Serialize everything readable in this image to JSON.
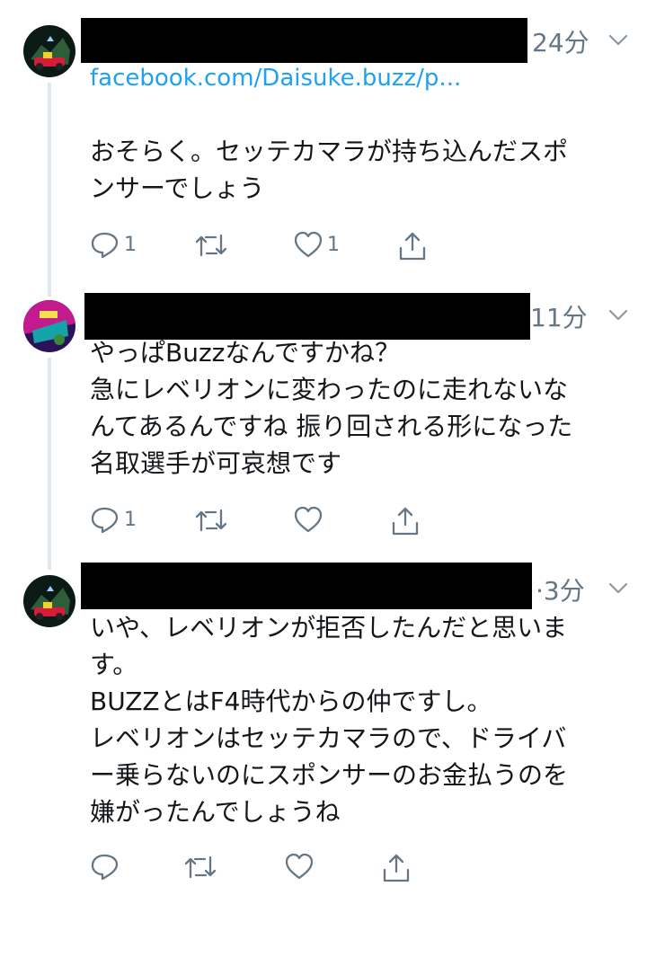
{
  "tweets": [
    {
      "time": "24分",
      "link": "facebook.com/Daisuke.buzz/p...",
      "lines": [
        "おそらく。セッテカマラが持ち込んだスポ",
        "ンサーでしょう"
      ],
      "reply_count": "1",
      "like_count": "1"
    },
    {
      "time": "11分",
      "lines": [
        "やっぱBuzzなんですかね？",
        "急にレベリオンに変わったのに走れないな",
        "んてあるんですね 振り回される形になった",
        "名取選手が可哀想です"
      ],
      "reply_count": "1"
    },
    {
      "time": "·3分",
      "lines": [
        "いや、レベリオンが拒否したんだと思いま",
        "す。",
        "BUZZとはF4時代からの仲ですし。",
        "レベリオンはセッテカマラので、ドライバ",
        "ー乗らないのにスポンサーのお金払うのを",
        "嫌がったんでしょうね"
      ]
    }
  ],
  "colors": {
    "link": "#1da1f2",
    "icon": "#657786",
    "line": "#e1e8ed"
  },
  "icons": [
    "reply-icon",
    "retweet-icon",
    "like-icon",
    "share-icon",
    "chevron-down-icon"
  ]
}
